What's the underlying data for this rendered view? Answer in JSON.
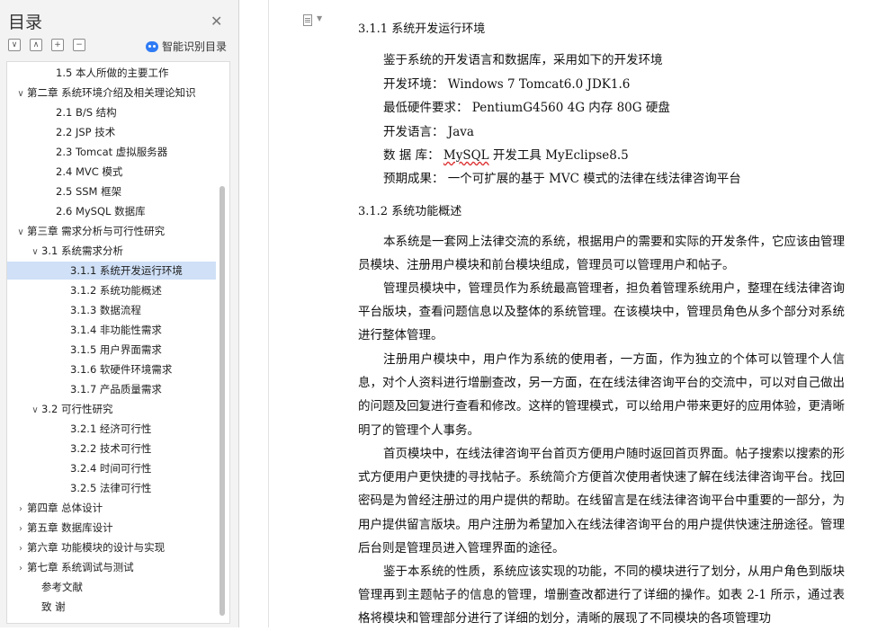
{
  "nav": {
    "title": "目录",
    "smart_label": "智能识别目录",
    "tools": [
      "∨",
      "∧",
      "+",
      "−"
    ],
    "items": [
      {
        "label": "1.5  本人所做的主要工作",
        "arrow": ""
      },
      {
        "label": "第二章  系统环境介绍及相关理论知识",
        "arrow": "∨"
      },
      {
        "label": "2.1 B/S 结构",
        "arrow": ""
      },
      {
        "label": "2.2 JSP 技术",
        "arrow": ""
      },
      {
        "label": "2.3 Tomcat 虚拟服务器",
        "arrow": ""
      },
      {
        "label": "2.4 MVC 模式",
        "arrow": ""
      },
      {
        "label": "2.5 SSM 框架",
        "arrow": ""
      },
      {
        "label": "2.6 MySQL 数据库",
        "arrow": ""
      },
      {
        "label": "第三章  需求分析与可行性研究",
        "arrow": "∨"
      },
      {
        "label": "3.1  系统需求分析",
        "arrow": "∨"
      },
      {
        "label": "3.1.1  系统开发运行环境",
        "arrow": ""
      },
      {
        "label": "3.1.2  系统功能概述",
        "arrow": ""
      },
      {
        "label": "3.1.3  数据流程",
        "arrow": ""
      },
      {
        "label": "3.1.4  非功能性需求",
        "arrow": ""
      },
      {
        "label": "3.1.5  用户界面需求",
        "arrow": ""
      },
      {
        "label": "3.1.6  软硬件环境需求",
        "arrow": ""
      },
      {
        "label": "3.1.7  产品质量需求",
        "arrow": ""
      },
      {
        "label": "3.2  可行性研究",
        "arrow": "∨"
      },
      {
        "label": "3.2.1  经济可行性",
        "arrow": ""
      },
      {
        "label": "3.2.2  技术可行性",
        "arrow": ""
      },
      {
        "label": "3.2.4  时间可行性",
        "arrow": ""
      },
      {
        "label": "3.2.5  法律可行性",
        "arrow": ""
      },
      {
        "label": "第四章  总体设计",
        "arrow": "›"
      },
      {
        "label": "第五章  数据库设计",
        "arrow": "›"
      },
      {
        "label": "第六章  功能模块的设计与实现",
        "arrow": "›"
      },
      {
        "label": "第七章  系统调试与测试",
        "arrow": "›"
      },
      {
        "label": "参考文献",
        "arrow": ""
      },
      {
        "label": "致    谢",
        "arrow": ""
      }
    ]
  },
  "doc": {
    "section_311": "3.1.1  系统开发运行环境",
    "env_intro": "鉴于系统的开发语言和数据库，采用如下的开发环境",
    "env_dev": "开发环境：  Windows 7    Tomcat6.0    JDK1.6",
    "env_hw": "最低硬件要求：  PentiumG4560    4G 内存    80G 硬盘",
    "env_lang": "开发语言：  Java",
    "env_db_label": "数  据  库：  ",
    "env_db_word": "MySQL",
    "env_db_rest": " 开发工具    MyEclipse8.5",
    "env_result": "预期成果：  一个可扩展的基于 MVC 模式的法律在线法律咨询平台",
    "section_312": "3.1.2  系统功能概述",
    "p1": "本系统是一套网上法律交流的系统，根据用户的需要和实际的开发条件，它应该由管理员模块、注册用户模块和前台模块组成，管理员可以管理用户和帖子。",
    "p2": "管理员模块中，管理员作为系统最高管理者，担负着管理系统用户，整理在线法律咨询平台版块，查看问题信息以及整体的系统管理。在该模块中，管理员角色从多个部分对系统进行整体管理。",
    "p3": "注册用户模块中，用户作为系统的使用者，一方面，作为独立的个体可以管理个人信息，对个人资料进行增删查改，另一方面，在在线法律咨询平台的交流中，可以对自己做出的问题及回复进行查看和修改。这样的管理模式，可以给用户带来更好的应用体验，更清晰明了的管理个人事务。",
    "p4": "首页模块中，在线法律咨询平台首页方便用户随时返回首页界面。帖子搜索以搜索的形式方便用户更快捷的寻找帖子。系统简介方便首次使用者快速了解在线法律咨询平台。找回密码是为曾经注册过的用户提供的帮助。在线留言是在线法律咨询平台中重要的一部分，为用户提供留言版块。用户注册为希望加入在线法律咨询平台的用户提供快速注册途径。管理后台则是管理员进入管理界面的途径。",
    "p5": "鉴于本系统的性质，系统应该实现的功能，不同的模块进行了划分，从用户角色到版块管理再到主题帖子的信息的管理，增删查改都进行了详细的操作。如表 2-1 所示，通过表格将模块和管理部分进行了详细的划分，清晰的展现了不同模块的各项管理功"
  }
}
